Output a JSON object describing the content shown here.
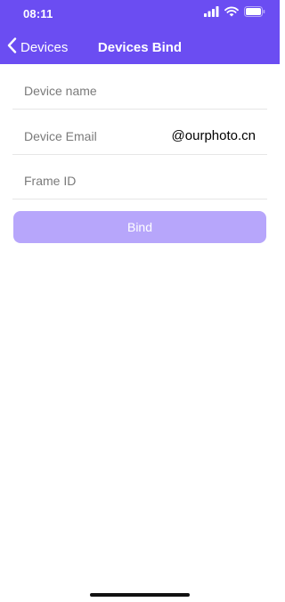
{
  "status_bar": {
    "time": "08:11",
    "icons": [
      "cellular-signal-icon",
      "wifi-icon",
      "battery-icon"
    ]
  },
  "nav": {
    "back_label": "Devices",
    "back_icon": "chevron-left-icon",
    "title": "Devices Bind"
  },
  "form": {
    "device_name_placeholder": "Device name",
    "device_email_placeholder": "Device Email",
    "email_suffix": "@ourphoto.cn",
    "frame_id_placeholder": "Frame ID",
    "bind_label": "Bind"
  },
  "colors": {
    "header": "#6b4df2",
    "button_disabled": "#b7a6fb",
    "placeholder": "#7a7a7a"
  }
}
